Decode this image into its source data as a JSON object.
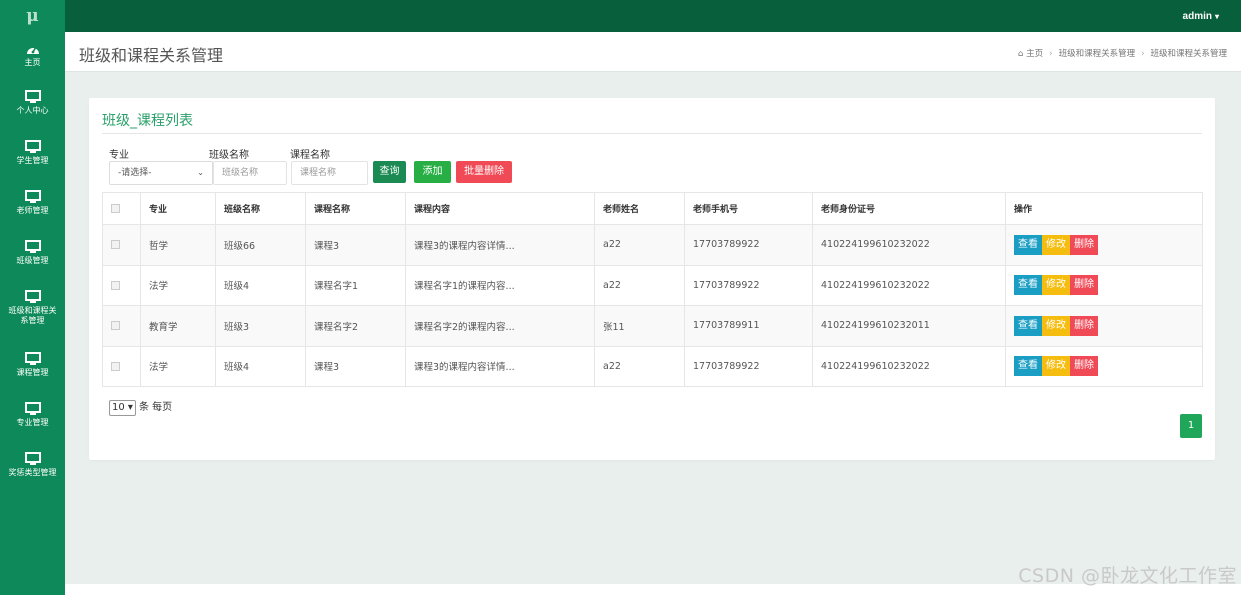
{
  "brand": {
    "logo": "μ"
  },
  "topbar": {
    "user": "admin"
  },
  "sidebar": {
    "items": [
      {
        "label": "主页",
        "icon": "dashboard-icon"
      },
      {
        "label": "个人中心",
        "icon": "monitor-icon"
      },
      {
        "label": "学生管理",
        "icon": "monitor-icon"
      },
      {
        "label": "老师管理",
        "icon": "monitor-icon"
      },
      {
        "label": "班级管理",
        "icon": "monitor-icon"
      },
      {
        "label": "班级和课程关系管理",
        "icon": "monitor-icon"
      },
      {
        "label": "课程管理",
        "icon": "monitor-icon"
      },
      {
        "label": "专业管理",
        "icon": "monitor-icon"
      },
      {
        "label": "奖惩类型管理",
        "icon": "monitor-icon"
      }
    ]
  },
  "header": {
    "title": "班级和课程关系管理",
    "breadcrumb": [
      "主页",
      "班级和课程关系管理",
      "班级和课程关系管理"
    ]
  },
  "card": {
    "title": "班级_课程列表"
  },
  "filters": {
    "major_label": "专业",
    "major_value": "-请选择-",
    "class_label": "班级名称",
    "class_placeholder": "班级名称",
    "course_label": "课程名称",
    "course_placeholder": "课程名称",
    "query_button": "查询",
    "add_button": "添加",
    "batch_delete_button": "批量删除"
  },
  "table": {
    "headers": [
      "专业",
      "班级名称",
      "课程名称",
      "课程内容",
      "老师姓名",
      "老师手机号",
      "老师身份证号",
      "操作"
    ],
    "rows": [
      {
        "major": "哲学",
        "class": "班级66",
        "course": "课程3",
        "content": "课程3的课程内容详情...",
        "teacher": "a22",
        "phone": "17703789922",
        "idcard": "410224199610232022"
      },
      {
        "major": "法学",
        "class": "班级4",
        "course": "课程名字1",
        "content": "课程名字1的课程内容...",
        "teacher": "a22",
        "phone": "17703789922",
        "idcard": "410224199610232022"
      },
      {
        "major": "教育学",
        "class": "班级3",
        "course": "课程名字2",
        "content": "课程名字2的课程内容...",
        "teacher": "张11",
        "phone": "17703789911",
        "idcard": "410224199610232011"
      },
      {
        "major": "法学",
        "class": "班级4",
        "course": "课程3",
        "content": "课程3的课程内容详情...",
        "teacher": "a22",
        "phone": "17703789922",
        "idcard": "410224199610232022"
      }
    ],
    "actions": {
      "view": "查看",
      "edit": "修改",
      "delete": "删除"
    }
  },
  "pager": {
    "page_size": "10",
    "page_size_suffix": "条 每页",
    "current_page": "1"
  },
  "watermark": "CSDN @卧龙文化工作室",
  "colors": {
    "topbar": "#085f3b",
    "sidebar": "#0e8a5a",
    "accent": "#2aa06a",
    "danger": "#f04a57",
    "warning": "#f5bd10",
    "info": "#1a9ec4"
  }
}
